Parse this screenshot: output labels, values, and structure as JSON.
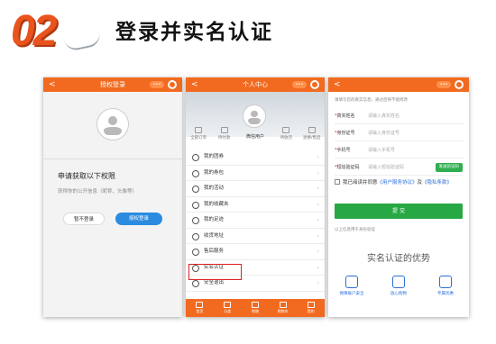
{
  "header": {
    "step": "02",
    "title": "登录并实名认证"
  },
  "phone1": {
    "bar_title": "授权登录",
    "back": "<",
    "menu": "•••",
    "prompt_title": "申请获取以下权限",
    "prompt_sub": "获得你的公开信息（昵称、头像等）",
    "deny_label": "暂不登录",
    "allow_label": "授权登录",
    "accent": "#f26a1f",
    "allow_color": "#2a8be0"
  },
  "phone2": {
    "bar_title": "个人中心",
    "back": "<",
    "menu": "•••",
    "user": "微信用户",
    "quick": [
      "全部订单",
      "待付款",
      "待发货",
      "待收货",
      "退换/售后"
    ],
    "menu_items": [
      "我的团券",
      "我的券包",
      "我的活动",
      "我的收藏夹",
      "我的足迹",
      "收货地址",
      "售后服务",
      "实名认证",
      "安全退出"
    ],
    "tabs": [
      "首页",
      "分类",
      "购物",
      "购物车",
      "我的"
    ]
  },
  "phone3": {
    "bar_title": "",
    "back": "<",
    "menu": "•••",
    "tip": "请填写您的真实信息，通过后将不能修改",
    "fields": [
      {
        "label": "真实姓名",
        "placeholder": "请输入真实姓名"
      },
      {
        "label": "身份证号",
        "placeholder": "请输入身份证号"
      },
      {
        "label": "手机号",
        "placeholder": "请输入手机号"
      },
      {
        "label": "短信验证码",
        "placeholder": "请输入短信验证码"
      }
    ],
    "required_mark": "*",
    "verify_btn": "发送验证码",
    "agree_text": "我已阅读并同意",
    "terms1": "《用户服务协议》",
    "and": "及",
    "terms2": "《隐私条款》",
    "submit": "提 交",
    "skip": "以上信息用于身份验证",
    "advantage_title": "实名认证的优势",
    "benefits": [
      "保障账户安全",
      "放心购物",
      "专属优惠"
    ]
  }
}
